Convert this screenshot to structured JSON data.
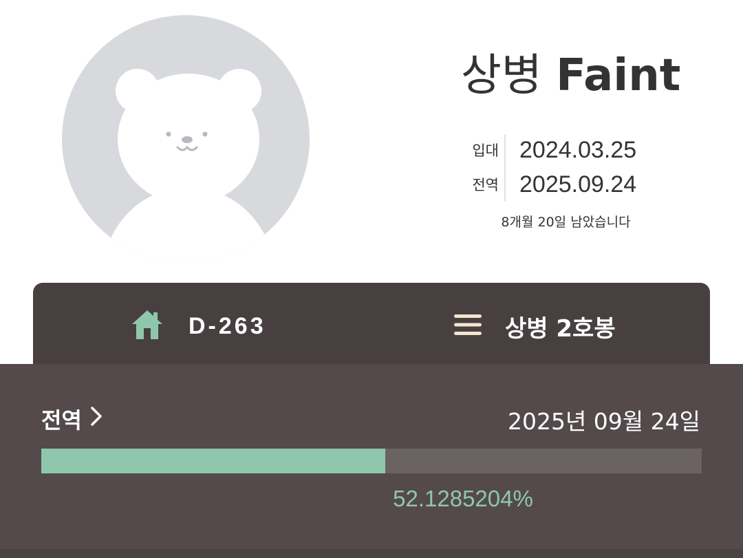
{
  "profile": {
    "rank": "상병",
    "name": "Faint"
  },
  "dates": {
    "enlist_label": "입대",
    "enlist_date": "2024.03.25",
    "discharge_label": "전역",
    "discharge_date": "2025.09.24",
    "remaining": "8개월 20일 남았습니다"
  },
  "tabs": {
    "dday_icon": "home-icon",
    "dday_label": "D-263",
    "rank_icon": "menu-icon",
    "rank_label": "상병 2호봉"
  },
  "progress": {
    "link_label": "전역",
    "link_icon": "chevron-right-icon",
    "target_date": "2025년 09월 24일",
    "percent_text": "52.1285204%",
    "fraction": 0.521285204
  },
  "colors": {
    "accent": "#8fc7ad",
    "dark_bar": "#483f40",
    "panel": "#544a4b",
    "track": "#6b6263",
    "avatar_bg": "#d7d9dd"
  }
}
